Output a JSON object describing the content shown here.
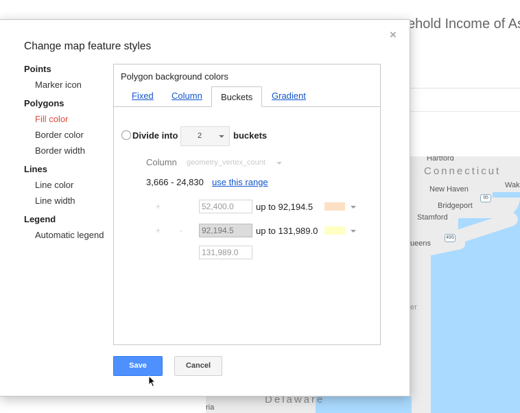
{
  "background": {
    "title": "ehold Income of As",
    "map_labels": {
      "hartford": "Hartford",
      "connecticut": "Connecticut",
      "new_haven": "New Haven",
      "wake": "Wak",
      "bridgeport": "Bridgeport",
      "stamford": "Stamford",
      "queens": "ueens",
      "route_95": "95",
      "route_495": "495",
      "er": "er",
      "delaware": "Delaware",
      "ria": "ria"
    }
  },
  "dialog": {
    "title": "Change map feature styles",
    "close": "×",
    "nav": {
      "points": {
        "heading": "Points",
        "items": [
          "Marker icon"
        ]
      },
      "polygons": {
        "heading": "Polygons",
        "items": [
          "Fill color",
          "Border color",
          "Border width"
        ],
        "active": "Fill color"
      },
      "lines": {
        "heading": "Lines",
        "items": [
          "Line color",
          "Line width"
        ]
      },
      "legend": {
        "heading": "Legend",
        "items": [
          "Automatic legend"
        ]
      }
    },
    "panel": {
      "title": "Polygon background colors",
      "tabs": [
        "Fixed",
        "Column",
        "Buckets",
        "Gradient"
      ],
      "active_tab": "Buckets",
      "divide_label": "Divide into",
      "bucket_count": "2",
      "buckets_label": "buckets",
      "column_label": "Column",
      "column_value": "geometry_vertex_count",
      "range_text": "3,666 - 24,830",
      "use_range_link": "use this range",
      "buckets": [
        {
          "plus": "+",
          "minus": "",
          "from": "52,400.0",
          "upto": "up to 92,194.5",
          "color": "#fce0c4"
        },
        {
          "plus": "+",
          "minus": "-",
          "from": "92,194.5",
          "upto": "up to 131,989.0",
          "color": "#ffffc4"
        }
      ],
      "last_value": "131,989.0"
    },
    "save": "Save",
    "cancel": "Cancel"
  }
}
